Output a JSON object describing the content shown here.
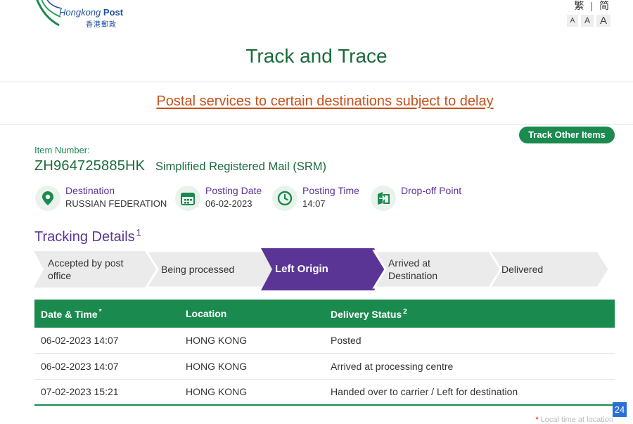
{
  "header": {
    "logo_en_1": "Hongkong",
    "logo_en_2": "Post",
    "logo_zh": "香港郵政",
    "lang_trad": "繁",
    "lang_sep": "|",
    "lang_simp": "简",
    "font_small": "A",
    "font_medium": "A",
    "font_large": "A"
  },
  "page_title": "Track and Trace",
  "notice": "Postal services to certain destinations subject to delay",
  "track_other_label": "Track Other Items",
  "item": {
    "label": "Item Number:",
    "number": "ZH964725885HK",
    "type": "Simplified Registered Mail (SRM)"
  },
  "info": [
    {
      "icon": "location-pin-icon",
      "label": "Destination",
      "value": "RUSSIAN FEDERATION"
    },
    {
      "icon": "calendar-icon",
      "label": "Posting Date",
      "value": "06-02-2023"
    },
    {
      "icon": "clock-icon",
      "label": "Posting Time",
      "value": "14:07"
    },
    {
      "icon": "drop-off-icon",
      "label": "Drop-off Point",
      "value": ""
    }
  ],
  "tracking_details": {
    "title": "Tracking Details",
    "note": "1"
  },
  "steps": [
    {
      "line1": "Accepted by post",
      "line2": "office",
      "active": false
    },
    {
      "line1": "Being processed",
      "line2": "",
      "active": false
    },
    {
      "line1": "Left Origin",
      "line2": "",
      "active": true
    },
    {
      "line1": "Arrived at",
      "line2": "Destination",
      "active": false
    },
    {
      "line1": "Delivered",
      "line2": "",
      "active": false
    }
  ],
  "table": {
    "headers": {
      "datetime": "Date & Time",
      "datetime_mark": "*",
      "location": "Location",
      "status": "Delivery Status",
      "status_mark": "2"
    },
    "rows": [
      {
        "datetime": "06-02-2023 14:07",
        "location": "HONG KONG",
        "status": "Posted"
      },
      {
        "datetime": "06-02-2023 14:07",
        "location": "HONG KONG",
        "status": "Arrived at processing centre"
      },
      {
        "datetime": "07-02-2023 15:21",
        "location": "HONG KONG",
        "status": "Handed over to carrier / Left for destination"
      }
    ]
  },
  "page_badge": "24",
  "footnote": {
    "mark": "*",
    "text": "Local time at location"
  },
  "colors": {
    "primary_green": "#1a8a4f",
    "title_green": "#1a6b3c",
    "purple": "#5a3596",
    "notice_orange": "#c6511b",
    "step_grey": "#ebebeb"
  }
}
